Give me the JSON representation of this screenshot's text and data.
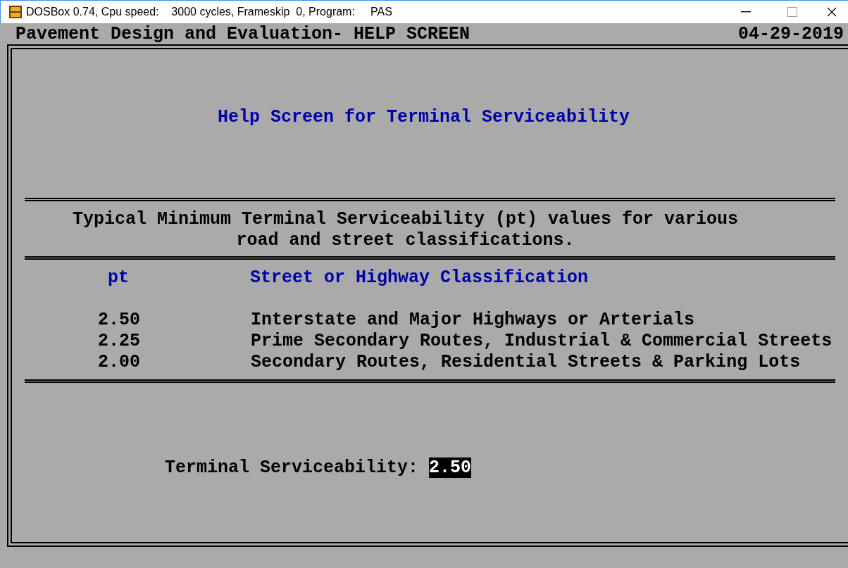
{
  "window": {
    "title": "DOSBox 0.74, Cpu speed:    3000 cycles, Frameskip  0, Program:     PAS"
  },
  "header": {
    "title": "Pavement Design and Evaluation- HELP SCREEN",
    "date": "04-29-2019"
  },
  "help_title": "Help Screen for Terminal Serviceability",
  "intro": [
    "Typical Minimum Terminal Serviceability (pt) values for various",
    "road and street classifications."
  ],
  "table": {
    "columns": [
      "pt",
      "Street or Highway Classification"
    ],
    "rows": [
      {
        "pt": "2.50",
        "classification": "Interstate and Major Highways or Arterials"
      },
      {
        "pt": "2.25",
        "classification": "Prime Secondary Routes, Industrial & Commercial Streets"
      },
      {
        "pt": "2.00",
        "classification": "Secondary Routes, Residential Streets & Parking Lots"
      }
    ]
  },
  "field": {
    "label": "Terminal Serviceability:",
    "value": "2.50"
  }
}
